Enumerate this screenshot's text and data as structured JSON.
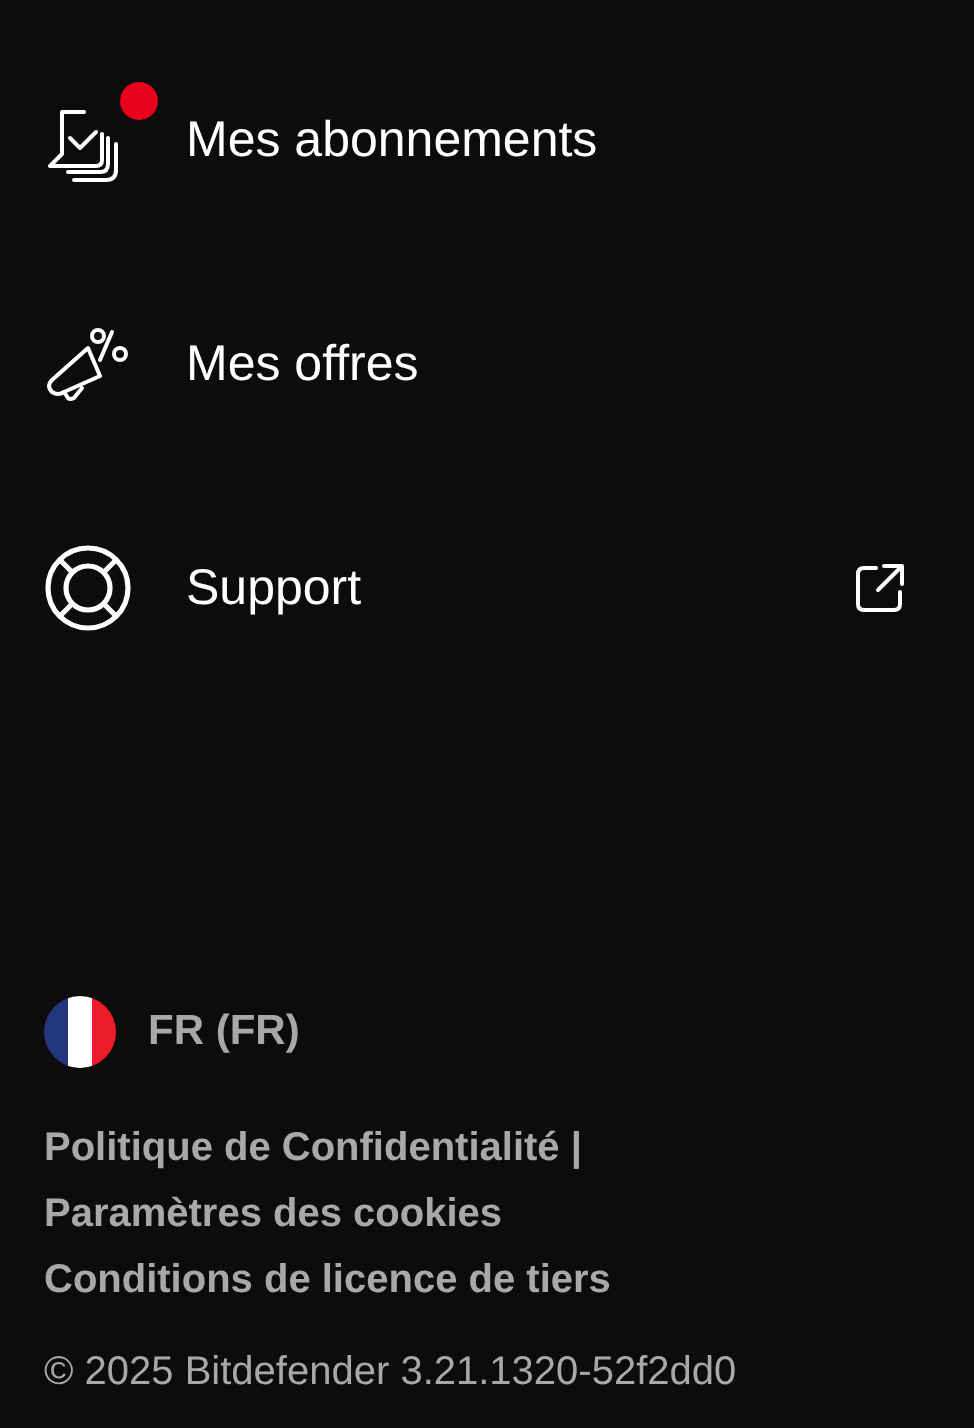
{
  "menu": [
    {
      "kind": "subscriptions",
      "label": "Mes abonnements",
      "badge": true,
      "external": false
    },
    {
      "kind": "offers",
      "label": "Mes offres",
      "badge": false,
      "external": false
    },
    {
      "kind": "support",
      "label": "Support",
      "badge": false,
      "external": true
    }
  ],
  "language": {
    "label": "FR (FR)"
  },
  "links": [
    "Politique de Confidentialité |",
    "Paramètres des cookies",
    "Conditions de licence de tiers"
  ],
  "copyright": "© 2025 Bitdefender 3.21.1320-52f2dd0"
}
